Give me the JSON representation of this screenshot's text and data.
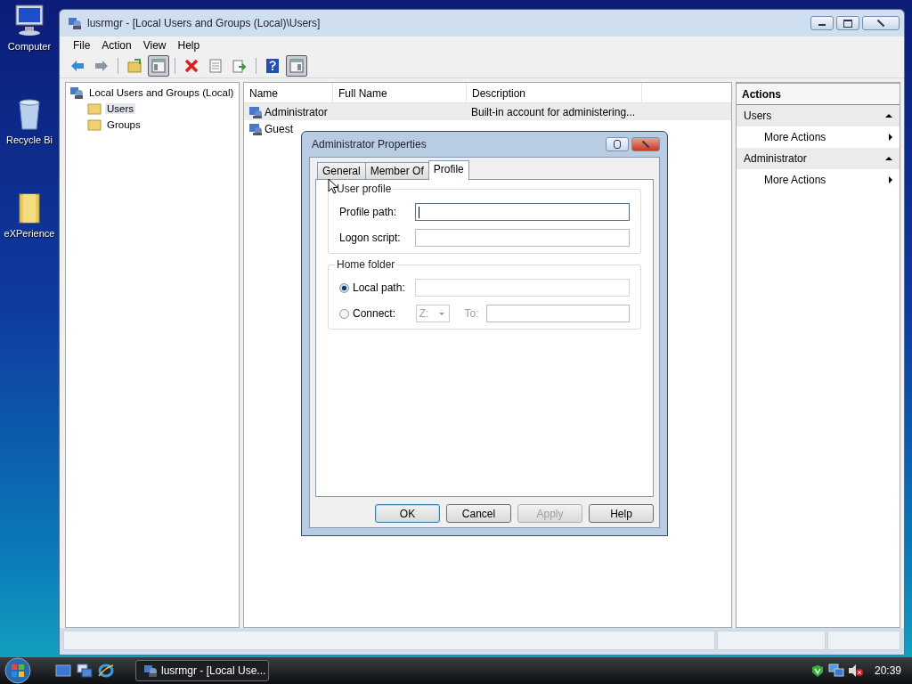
{
  "desktop_icons": [
    {
      "label": "Computer"
    },
    {
      "label": "Recycle Bi"
    },
    {
      "label": "eXPerience"
    }
  ],
  "window": {
    "title": "lusrmgr - [Local Users and Groups (Local)\\Users]"
  },
  "menu": [
    "File",
    "Action",
    "View",
    "Help"
  ],
  "toolbar": [
    {
      "pressed": false
    },
    {
      "pressed": false
    },
    {
      "pressed": false
    },
    {
      "pressed": true
    },
    {
      "pressed": false
    },
    {
      "pressed": false
    },
    {
      "pressed": false
    },
    {
      "pressed": false
    },
    {
      "pressed": true
    }
  ],
  "tree": [
    {
      "label": "Local Users and Groups (Local)",
      "selected": false,
      "children": [
        {
          "label": "Users",
          "selected": true
        },
        {
          "label": "Groups",
          "selected": false
        }
      ]
    }
  ],
  "list": {
    "columns": [
      "Name",
      "Full Name",
      "Description"
    ],
    "rows": [
      {
        "name": "Administrator",
        "description": "Built-in account for administering...",
        "selected": true
      },
      {
        "name": "Guest",
        "selected": false
      }
    ]
  },
  "actions": {
    "title": "Actions",
    "sections": [
      {
        "title": "Users",
        "expanded": true,
        "items": [
          "More Actions"
        ]
      },
      {
        "title": "Administrator",
        "expanded": true,
        "items": [
          "More Actions"
        ]
      }
    ]
  },
  "dialog": {
    "title": "Administrator Properties",
    "tabs": [
      {
        "label": "General",
        "selected": false
      },
      {
        "label": "Member Of",
        "selected": false
      },
      {
        "label": "Profile",
        "selected": true
      }
    ],
    "user_profile": {
      "legend": "User profile",
      "fields": [
        {
          "label": "Profile path:",
          "focused": true
        },
        {
          "label": "Logon script:",
          "focused": false
        }
      ]
    },
    "home_folder": {
      "legend": "Home folder",
      "options": [
        {
          "label": "Local path:",
          "selected": true
        },
        {
          "label": "Connect:",
          "selected": false
        }
      ],
      "drive": {
        "value": "Z:",
        "disabled": true
      },
      "to_label": "To:"
    },
    "buttons": [
      {
        "label": "OK",
        "default": true,
        "disabled": false
      },
      {
        "label": "Cancel",
        "default": false,
        "disabled": false
      },
      {
        "label": "Apply",
        "default": false,
        "disabled": true
      },
      {
        "label": "Help",
        "default": false,
        "disabled": false
      }
    ]
  },
  "taskbar": {
    "task": "lusrmgr - [Local Use...",
    "clock": "20:39"
  }
}
